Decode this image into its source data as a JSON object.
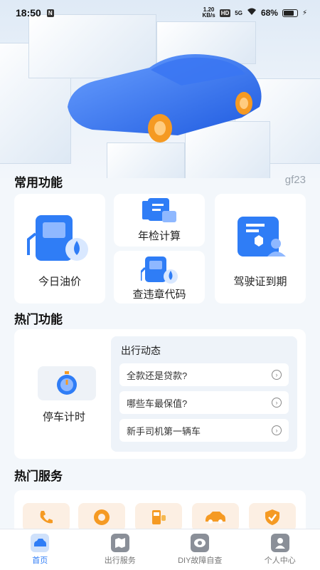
{
  "status_bar": {
    "time": "18:50",
    "network_speed_top": "1.20",
    "network_speed_unit": "KB/s",
    "hd_badge": "HD",
    "signal_label": "5G",
    "battery": "68%"
  },
  "common": {
    "title": "常用功能",
    "code": "gf23",
    "items": [
      {
        "label": "今日油价",
        "icon": "fuel-pump-icon"
      },
      {
        "label": "年检计算",
        "icon": "document-calc-icon"
      },
      {
        "label": "查违章代码",
        "icon": "violation-code-icon"
      },
      {
        "label": "驾驶证到期",
        "icon": "license-expire-icon"
      }
    ]
  },
  "hot_functions": {
    "title": "热门功能",
    "parking_label": "停车计时",
    "news_title": "出行动态",
    "news": [
      {
        "text": "全款还是贷款?"
      },
      {
        "text": "哪些车最保值?"
      },
      {
        "text": "新手司机第一辆车"
      }
    ]
  },
  "hot_services": {
    "title": "热门服务",
    "icons": [
      "phone-icon",
      "wheel-icon",
      "fuel-icon",
      "car-icon",
      "shield-check-icon"
    ]
  },
  "tabbar": {
    "tabs": [
      {
        "label": "首页",
        "icon": "home-car-icon",
        "active": true
      },
      {
        "label": "出行服务",
        "icon": "map-icon",
        "active": false
      },
      {
        "label": "DIY故障自查",
        "icon": "diagnose-icon",
        "active": false
      },
      {
        "label": "个人中心",
        "icon": "person-icon",
        "active": false
      }
    ]
  },
  "colors": {
    "accent": "#2f7df6",
    "car_blue": "#2b6ef5",
    "wheel_orange": "#f59a23"
  }
}
